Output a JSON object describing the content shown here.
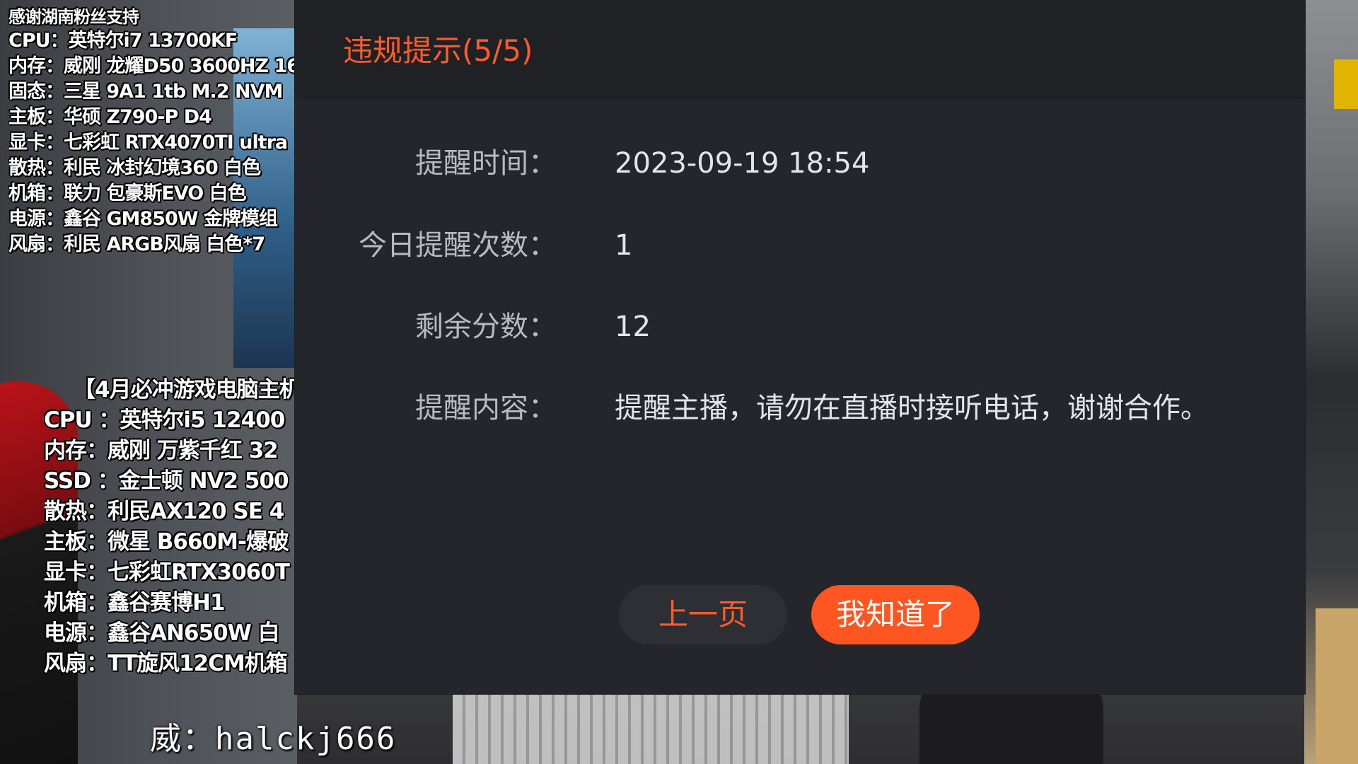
{
  "dialog": {
    "title": "违规提示(5/5)",
    "rows": [
      {
        "label": "提醒时间：",
        "value": "2023-09-19 18:54"
      },
      {
        "label": "今日提醒次数：",
        "value": "1"
      },
      {
        "label": "剩余分数：",
        "value": "12"
      },
      {
        "label": "提醒内容：",
        "value": "提醒主播，请勿在直播时接听电话，谢谢合作。"
      }
    ],
    "prev_button": "上一页",
    "confirm_button": "我知道了",
    "accent_color": "#ff5a2c"
  },
  "overlay_specs_1": [
    "感谢湖南粉丝支持",
    "CPU：英特尔i7 13700KF",
    "内存：威刚 龙耀D50 3600HZ 16",
    "固态：三星 9A1 1tb  M.2 NVM",
    "主板：华硕 Z790-P D4",
    "显卡：七彩虹 RTX4070TI ultra",
    "散热：利民 冰封幻境360 白色",
    "机箱：联力 包豪斯EVO 白色",
    "电源：鑫谷 GM850W 金牌模组",
    "风扇：利民 ARGB风扇 白色*7"
  ],
  "overlay_specs_2": [
    "【4月必冲游戏电脑主机",
    "CPU ：英特尔i5 12400",
    "内存：威刚 万紫千红 32",
    "SSD ：金士顿 NV2 500",
    "散热：利民AX120 SE 4",
    "主板：微星 B660M-爆破",
    "显卡：七彩虹RTX3060T",
    "机箱：鑫谷赛博H1",
    "电源：鑫谷AN650W 白",
    "风扇：TT旋风12CM机箱"
  ],
  "wechat_text": "威：halckj666"
}
